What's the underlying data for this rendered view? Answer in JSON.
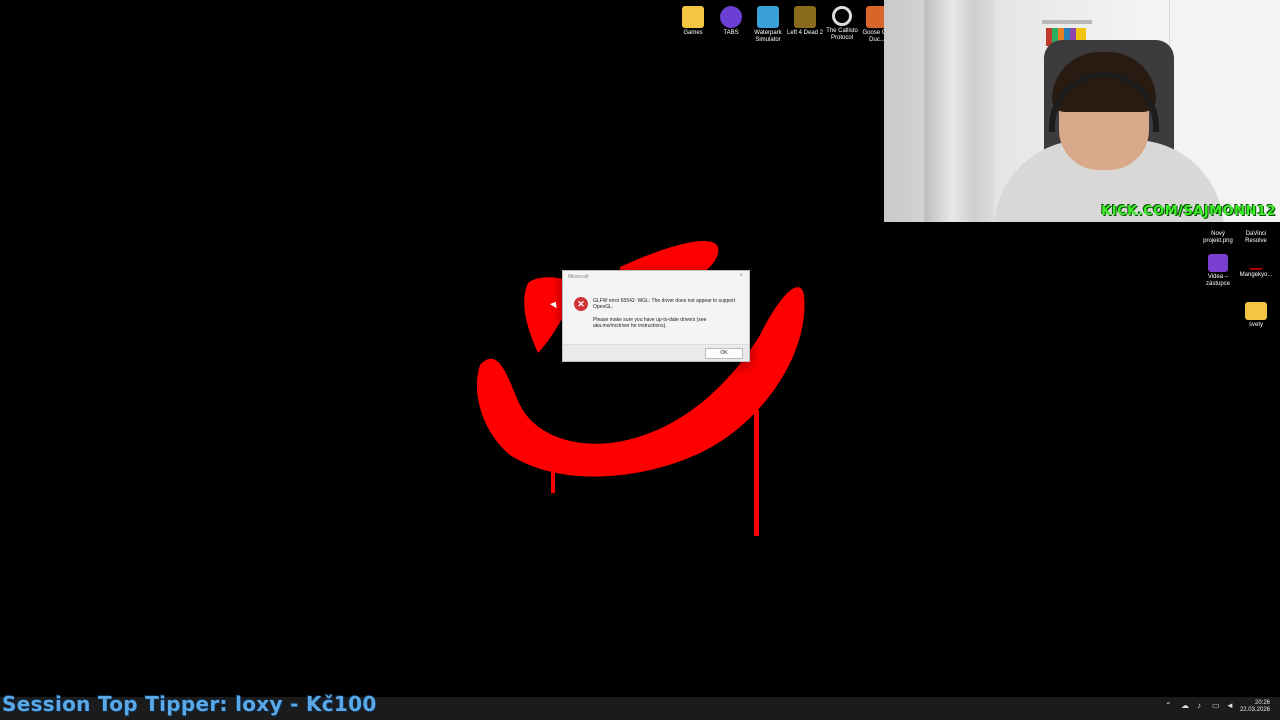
{
  "desktop_icons_top": [
    {
      "label": "Games",
      "icon": "folder-icon",
      "color": "#f4c542"
    },
    {
      "label": "TABS",
      "icon": "tabs-game-icon",
      "color": "#6b3fd4"
    },
    {
      "label": "Waterpark Simulator",
      "icon": "waterpark-icon",
      "color": "#3aa0d8"
    },
    {
      "label": "Left 4 Dead 2",
      "icon": "left4dead-icon",
      "color": "#8a6a1c"
    },
    {
      "label": "The Callisto Protocol",
      "icon": "callisto-icon",
      "color": "#222222"
    },
    {
      "label": "Goose G... Duc...",
      "icon": "goose-icon",
      "color": "#d8662a"
    }
  ],
  "desktop_icons_right": [
    {
      "label": "Nový projekt.png",
      "icon": "image-file-icon",
      "color": "#ffffff"
    },
    {
      "label": "DaVinci Resolve",
      "icon": "davinci-icon",
      "color": "#333333"
    },
    {
      "label": "Videa – zástupce",
      "icon": "video-shortcut-icon",
      "color": "#7b3fcf"
    },
    {
      "label": "Mangekyo...",
      "icon": "mangekyo-icon",
      "color": "#b00000"
    },
    {
      "label": "svety",
      "icon": "folder-icon",
      "color": "#f4c542"
    }
  ],
  "webcam": {
    "overlay_text": "KICK.COM/SAJMONN12"
  },
  "dialog": {
    "title": "Minecraft",
    "close": "×",
    "message_line1": "GLFW error 65542: WGL: The driver does not appear to support OpenGL.",
    "message_line2": "Please make sure you have up-to-date drivers (see aka.ms/mcdriver for instructions).",
    "ok_label": "OK"
  },
  "overlay": {
    "tipper_text": "Session Top Tipper: loxy - Kč100"
  },
  "clock": {
    "time": "20:26",
    "date": "22.03.2026"
  },
  "colors": {
    "graffiti": "#ff0000",
    "kick_green": "#3ef02a",
    "error_red": "#d13438"
  }
}
